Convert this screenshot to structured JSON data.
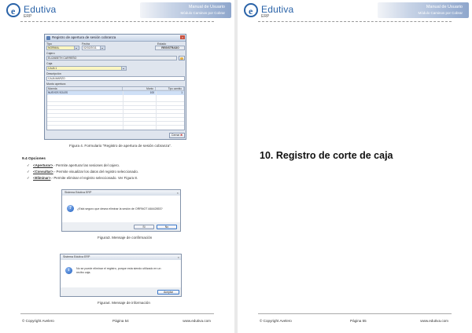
{
  "header": {
    "logo_text": "Edutiva",
    "logo_sub": "ERP",
    "banner_title": "Manual de Usuario",
    "banner_subtitle": "Módulo Caminos por Cobrar"
  },
  "page_left": {
    "dialog": {
      "title": "Registro de apertura de sesión cobranza",
      "tipo_label": "Tipo",
      "tipo_value": "NORMAL",
      "fecha_label": "Fecha",
      "fecha_value": "02/02/2011",
      "estado_label": "Estado",
      "estado_value": "REGISTRADO",
      "cajero_label": "Cajero",
      "cajero_value": "ELIZABETH CARREÑO",
      "caja_label": "Caja",
      "caja_value": "CAJA 1",
      "descripcion_label": "Descripción",
      "descripcion_value": "CAJA MARZO",
      "monto_label": "Monto apertura",
      "grid_headers": [
        "Moneda",
        "Monto",
        "Tipo cambio"
      ],
      "grid_row": [
        "NUEVOS SOLES",
        "100",
        "1"
      ],
      "cerrar_label": "Cerrar"
    },
    "figure4_caption": "Figura 4. Formulario \"Registro de apertura de sesión cobranza\".",
    "section_title": "9.4 Opciones",
    "bullets": [
      {
        "check": "✓",
        "key": "<Aperturar>",
        "text": ".- Permite aperturar las sesiones del cajero."
      },
      {
        "check": "✓",
        "key": "<Consultar>",
        "text": ".- Permite visualizar los datos del registro seleccionado."
      },
      {
        "check": "✓",
        "key": "<Eliminar>",
        "text": ".- Permite eliminar el registro seleccionado. Ver Figura 8."
      }
    ],
    "confirm_dialog": {
      "title": "Sistema Edutiva ERP",
      "message": "¿Está seguro que desea eliminar la sesión de ORRNOT A8442853?",
      "yes_label": "Sí",
      "no_label": "No"
    },
    "figure3_caption": "Figura3. Mensaje de confirmación",
    "info_dialog": {
      "title": "Sistema Edutiva ERP",
      "message_line1": "No se puede eliminar el registro, porque esta siendo utilizado en un",
      "message_line2": "recibo caja.",
      "ok_label": "Aceptar"
    },
    "figure4b_caption": "Figura4. Mensaje de información",
    "footer": {
      "copyright": "© Copyright Avelero",
      "page": "Página 54",
      "web": "www.edutiva.com"
    }
  },
  "page_right": {
    "title": "10. Registro de corte de caja",
    "footer": {
      "copyright": "© Copyright Avelero",
      "page": "Página 55",
      "web": "www.edutiva.com"
    }
  }
}
